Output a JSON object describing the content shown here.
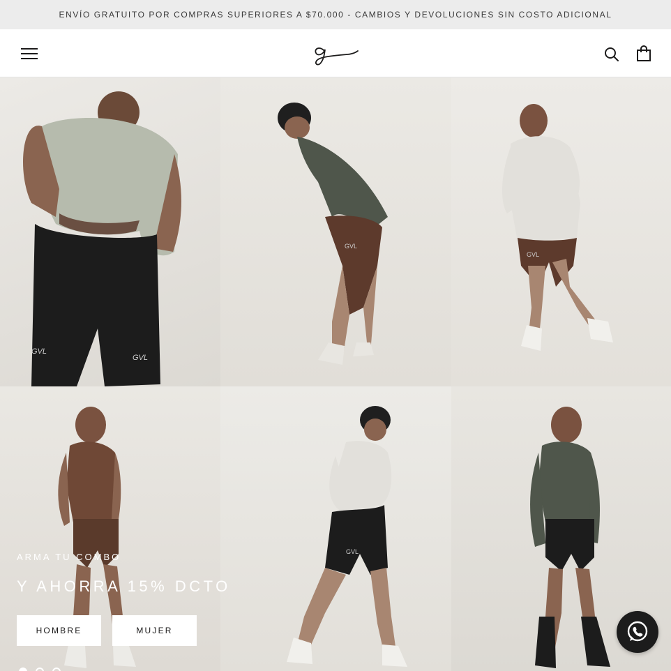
{
  "announcement": {
    "text": "ENVÍO GRATUITO POR COMPRAS SUPERIORES A $70.000 - CAMBIOS Y DEVOLUCIONES SIN COSTO ADICIONAL"
  },
  "header": {
    "menu_icon": "hamburger-menu-icon",
    "logo_icon": "brand-script-g-logo",
    "search_icon": "search-icon",
    "cart_icon": "shopping-bag-icon"
  },
  "hero": {
    "kicker": "ARMA TU COMBO",
    "headline": "Y AHORRA 15% DCTO",
    "buttons": [
      {
        "label": "HOMBRE"
      },
      {
        "label": "MUJER"
      }
    ],
    "slides": 3,
    "active_slide": 1,
    "images": [
      {
        "label": "GVL"
      },
      {
        "label": "GVL"
      },
      {
        "label": "GVL"
      },
      {
        "label": ""
      },
      {
        "label": "GVL"
      },
      {
        "label": ""
      }
    ]
  },
  "floating": {
    "whatsapp_icon": "whatsapp-icon"
  },
  "colors": {
    "announcement_bg": "#ececec",
    "text": "#1c1b1b",
    "accent_dark": "#1c1c1c",
    "white": "#ffffff"
  }
}
